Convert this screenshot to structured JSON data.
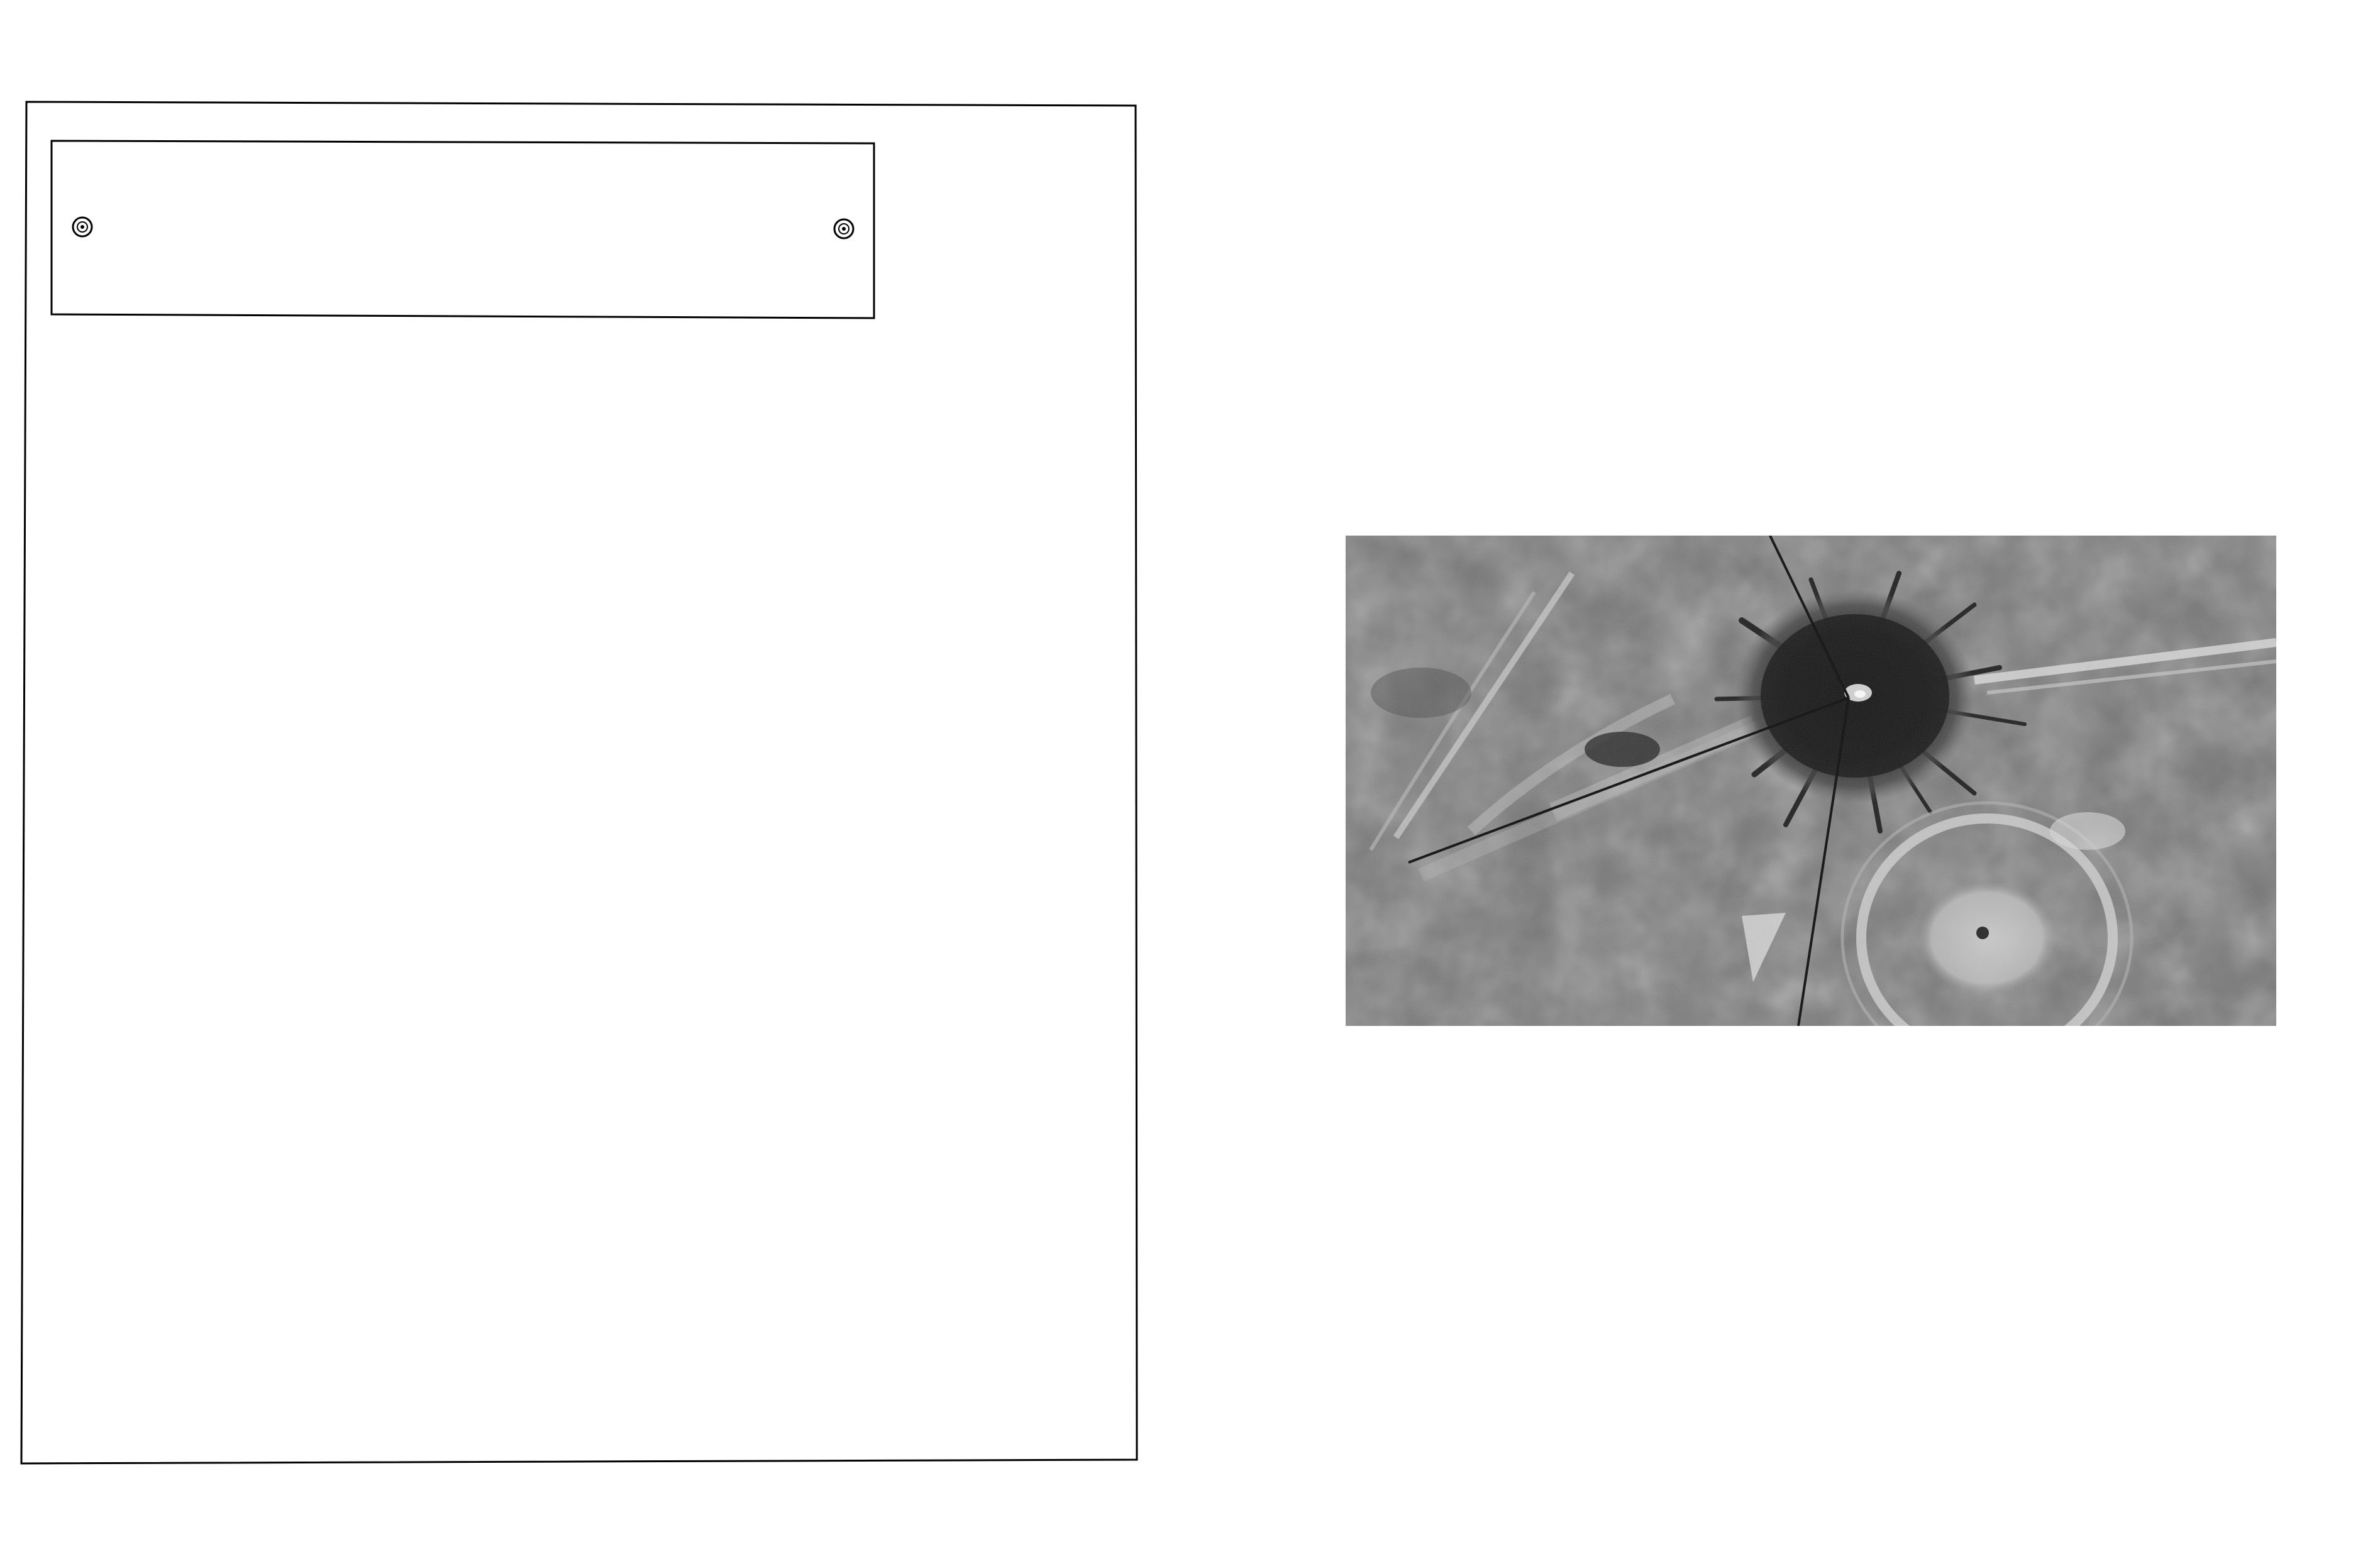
{
  "scene": {
    "left_panel": {
      "outer_outline_label": "",
      "plaque": {
        "text": "",
        "screws": [
          "screw-left",
          "screw-right"
        ]
      }
    },
    "photograph": {
      "style": "black-and-white aerial photo",
      "palette": {
        "paper": "#ffffff",
        "ink": "#000000",
        "ground_mid": "#6e6e6e",
        "ground_light": "#bdbdbd",
        "crater_dark": "#141414"
      }
    }
  }
}
